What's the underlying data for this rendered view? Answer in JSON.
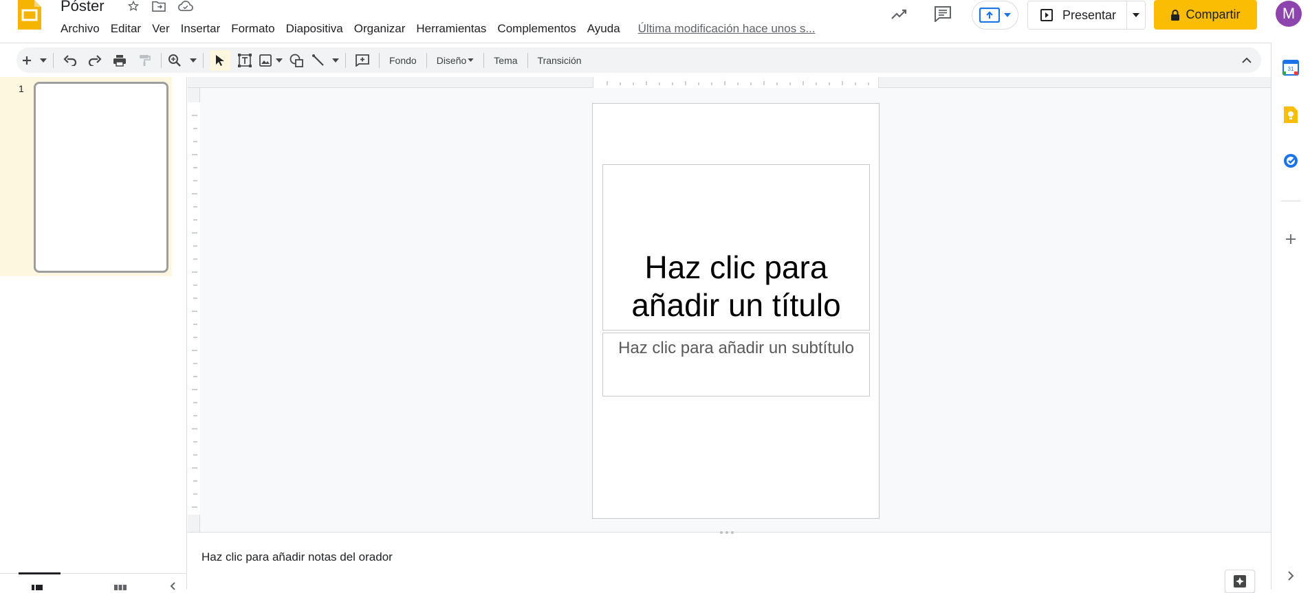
{
  "app": {
    "doc_title": "Póster",
    "last_edit": "Última modificación hace unos s...",
    "brand_color": "#fbbc04"
  },
  "menu": [
    "Archivo",
    "Editar",
    "Ver",
    "Insertar",
    "Formato",
    "Diapositiva",
    "Organizar",
    "Herramientas",
    "Complementos",
    "Ayuda"
  ],
  "header_actions": {
    "present_label": "Presentar",
    "share_label": "Compartir",
    "avatar_letter": "M",
    "avatar_color": "#8e44ad"
  },
  "toolbar": {
    "background_label": "Fondo",
    "layout_label": "Diseño",
    "theme_label": "Tema",
    "transition_label": "Transición"
  },
  "filmstrip": {
    "slides": [
      {
        "number": "1"
      }
    ]
  },
  "slide": {
    "title_placeholder_line1": "Haz clic para",
    "title_placeholder_line2": "añadir un título",
    "subtitle_placeholder": "Haz clic para añadir un subtítulo"
  },
  "notes": {
    "placeholder": "Haz clic para añadir notas del orador"
  },
  "side_panel": {
    "icons": [
      "calendar-icon",
      "keep-icon",
      "tasks-icon",
      "add-icon"
    ]
  }
}
